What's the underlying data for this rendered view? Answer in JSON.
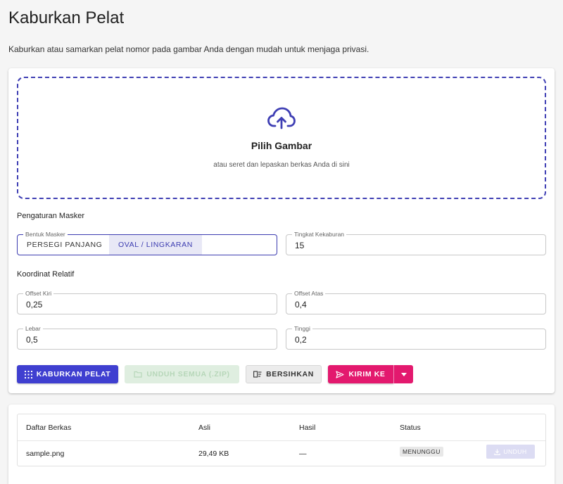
{
  "page": {
    "title": "Kaburkan Pelat",
    "description": "Kaburkan atau samarkan pelat nomor pada gambar Anda dengan mudah untuk menjaga privasi."
  },
  "dropzone": {
    "icon": "cloud-upload-icon",
    "title": "Pilih Gambar",
    "subtitle": "atau seret dan lepaskan berkas Anda di sini"
  },
  "mask_settings": {
    "section_label": "Pengaturan Masker",
    "shape": {
      "label": "Bentuk Masker",
      "options": [
        "PERSEGI PANJANG",
        "OVAL / LINGKARAN"
      ],
      "selected": "OVAL / LINGKARAN"
    },
    "blur": {
      "label": "Tingkat Kekaburan",
      "value": "15"
    }
  },
  "coordinates": {
    "section_label": "Koordinat Relatif",
    "offset_left": {
      "label": "Offset Kiri",
      "value": "0,25"
    },
    "offset_top": {
      "label": "Offset Atas",
      "value": "0,4"
    },
    "width": {
      "label": "Lebar",
      "value": "0,5"
    },
    "height": {
      "label": "Tinggi",
      "value": "0,2"
    }
  },
  "actions": {
    "blur_label": "KABURKAN PELAT",
    "download_all_label": "UNDUH SEMUA (.ZIP)",
    "clear_label": "BERSIHKAN",
    "send_label": "KIRIM KE"
  },
  "file_table": {
    "columns": [
      "Daftar Berkas",
      "Asli",
      "Hasil",
      "Status"
    ],
    "rows": [
      {
        "name": "sample.png",
        "original": "29,49 KB",
        "result": "—",
        "status": "MENUNGGU",
        "action": "UNDUH"
      }
    ]
  },
  "colors": {
    "primary": "#3f3fd0",
    "accent_pink": "#e3196e",
    "dropzone_border": "#3f3fb4"
  }
}
